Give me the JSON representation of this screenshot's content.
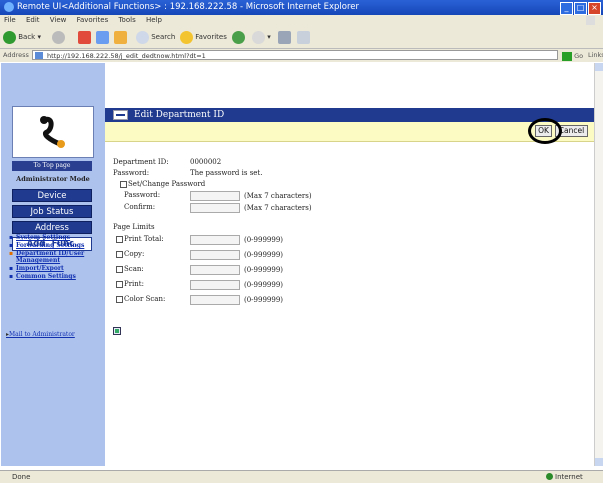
{
  "window": {
    "title": "Remote UI<Additional Functions> : 192.168.222.58 - Microsoft Internet Explorer"
  },
  "menu": [
    "File",
    "Edit",
    "View",
    "Favorites",
    "Tools",
    "Help"
  ],
  "toolbar": {
    "back": "Back",
    "search": "Search",
    "favorites": "Favorites"
  },
  "address": {
    "label": "Address",
    "url": "http://192.168.222.58/j_edit_dedtnow.html?dt=1",
    "go": "Go",
    "links": "Links"
  },
  "sidebar": {
    "top_page": "To Top page",
    "mode": "Administrator Mode",
    "buttons": [
      "Device",
      "Job Status",
      "Address",
      "Add. Func."
    ],
    "menu": [
      "System Settings",
      "Forwarding Settings",
      "Department ID/User Management",
      "Import/Export",
      "Common Settings"
    ],
    "mail": "Mail to Administrator"
  },
  "page": {
    "title": "Edit Department ID",
    "ok": "OK",
    "cancel": "Cancel",
    "dept_label": "Department ID:",
    "dept_value": "0000002",
    "password_label": "Password:",
    "password_value": "The password is set.",
    "set_change": "Set/Change Password",
    "pw_label": "Password:",
    "confirm_label": "Confirm:",
    "max_hint": "(Max 7 characters)",
    "page_limits": "Page Limits",
    "limits": [
      {
        "label": "Print Total:",
        "range": "(0-999999)"
      },
      {
        "label": "Copy:",
        "range": "(0-999999)"
      },
      {
        "label": "Scan:",
        "range": "(0-999999)"
      },
      {
        "label": "Print:",
        "range": "(0-999999)"
      },
      {
        "label": "Color Scan:",
        "range": "(0-999999)"
      }
    ]
  },
  "status": {
    "left": "Done",
    "right": "Internet"
  }
}
